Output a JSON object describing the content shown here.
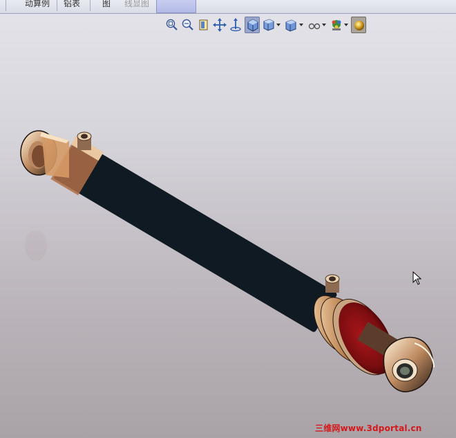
{
  "tab_bar": {
    "tabs": [
      {
        "label": "动算例"
      },
      {
        "label": "铝表"
      },
      {
        "label": "图"
      },
      {
        "label": "线显图"
      }
    ]
  },
  "view_toolbar": {
    "buttons": [
      {
        "icon": "zoom-to-fit-icon"
      },
      {
        "icon": "zoom-to-area-icon"
      },
      {
        "icon": "previous-view-icon"
      },
      {
        "icon": "pan-icon"
      },
      {
        "icon": "rotate-view-icon"
      },
      {
        "icon": "view-orientation-icon"
      },
      {
        "icon": "display-style-icon"
      },
      {
        "icon": "section-view-icon"
      },
      {
        "icon": "hide-show-items-icon"
      },
      {
        "icon": "edit-appearance-icon"
      },
      {
        "icon": "apply-scene-icon"
      }
    ]
  },
  "model": {
    "name": "hydraulic-cylinder",
    "body_color": "#c98a52",
    "end_cap_color": "#8a0f12"
  },
  "watermark": {
    "text": "三维网www.3dportal.cn",
    "color": "#d4181c"
  }
}
